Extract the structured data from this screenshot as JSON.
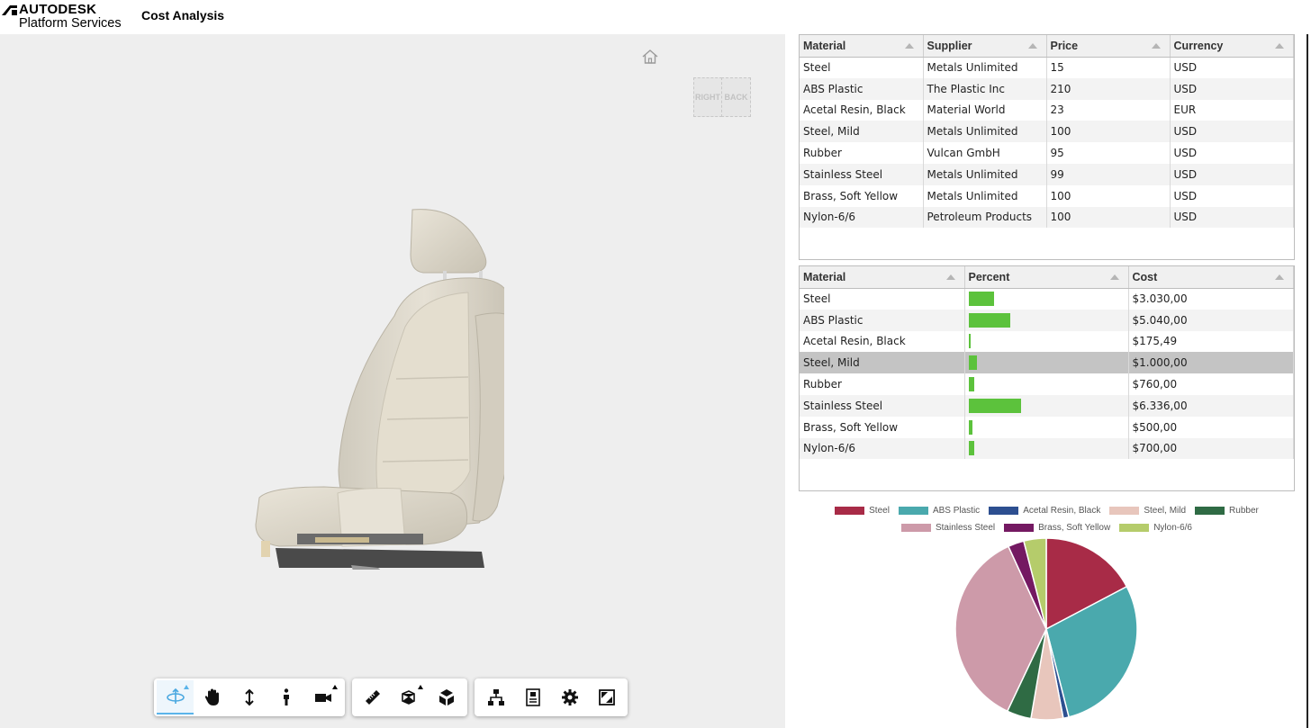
{
  "header": {
    "brand_name": "AUTODESK",
    "brand_sub": "Platform Services",
    "app_title": "Cost Analysis"
  },
  "viewer": {
    "viewcube": {
      "right_label": "RIGHT",
      "back_label": "BACK"
    },
    "toolbar_groups": [
      [
        "orbit-tool",
        "pan-tool",
        "zoom-tool",
        "first-person-tool",
        "camera-tool"
      ],
      [
        "measure-tool",
        "explode-tool",
        "section-tool"
      ],
      [
        "model-browser-tool",
        "properties-tool",
        "settings-tool",
        "fullscreen-tool"
      ]
    ]
  },
  "prices_table": {
    "columns": [
      "Material",
      "Supplier",
      "Price",
      "Currency"
    ],
    "rows": [
      [
        "Steel",
        "Metals Unlimited",
        "15",
        "USD"
      ],
      [
        "ABS Plastic",
        "The Plastic Inc",
        "210",
        "USD"
      ],
      [
        "Acetal Resin, Black",
        "Material World",
        "23",
        "EUR"
      ],
      [
        "Steel, Mild",
        "Metals Unlimited",
        "100",
        "USD"
      ],
      [
        "Rubber",
        "Vulcan GmbH",
        "95",
        "USD"
      ],
      [
        "Stainless Steel",
        "Metals Unlimited",
        "99",
        "USD"
      ],
      [
        "Brass, Soft Yellow",
        "Metals Unlimited",
        "100",
        "USD"
      ],
      [
        "Nylon-6/6",
        "Petroleum Products",
        "100",
        "USD"
      ]
    ]
  },
  "cost_table": {
    "columns": [
      "Material",
      "Percent",
      "Cost"
    ],
    "selected_row": 3,
    "rows": [
      {
        "material": "Steel",
        "percent": 16.5,
        "cost": "$3.030,00"
      },
      {
        "material": "ABS Plastic",
        "percent": 27.5,
        "cost": "$5.040,00"
      },
      {
        "material": "Acetal Resin, Black",
        "percent": 1.0,
        "cost": "$175,49"
      },
      {
        "material": "Steel, Mild",
        "percent": 5.5,
        "cost": "$1.000,00"
      },
      {
        "material": "Rubber",
        "percent": 4.1,
        "cost": "$760,00"
      },
      {
        "material": "Stainless Steel",
        "percent": 34.5,
        "cost": "$6.336,00"
      },
      {
        "material": "Brass, Soft Yellow",
        "percent": 2.7,
        "cost": "$500,00"
      },
      {
        "material": "Nylon-6/6",
        "percent": 3.8,
        "cost": "$700,00"
      }
    ],
    "bar_color": "#5cc23c"
  },
  "chart_data": {
    "type": "pie",
    "categories": [
      "Steel",
      "ABS Plastic",
      "Acetal Resin, Black",
      "Steel, Mild",
      "Rubber",
      "Stainless Steel",
      "Brass, Soft Yellow",
      "Nylon-6/6"
    ],
    "values": [
      3030.0,
      5040.0,
      175.49,
      1000.0,
      760.0,
      6336.0,
      500.0,
      700.0
    ],
    "colors": [
      "#a82b47",
      "#4aa9ad",
      "#2d4f90",
      "#e8c6bc",
      "#2f6b44",
      "#cd9aa9",
      "#741962",
      "#b5cc6b"
    ],
    "legend_position": "top"
  }
}
